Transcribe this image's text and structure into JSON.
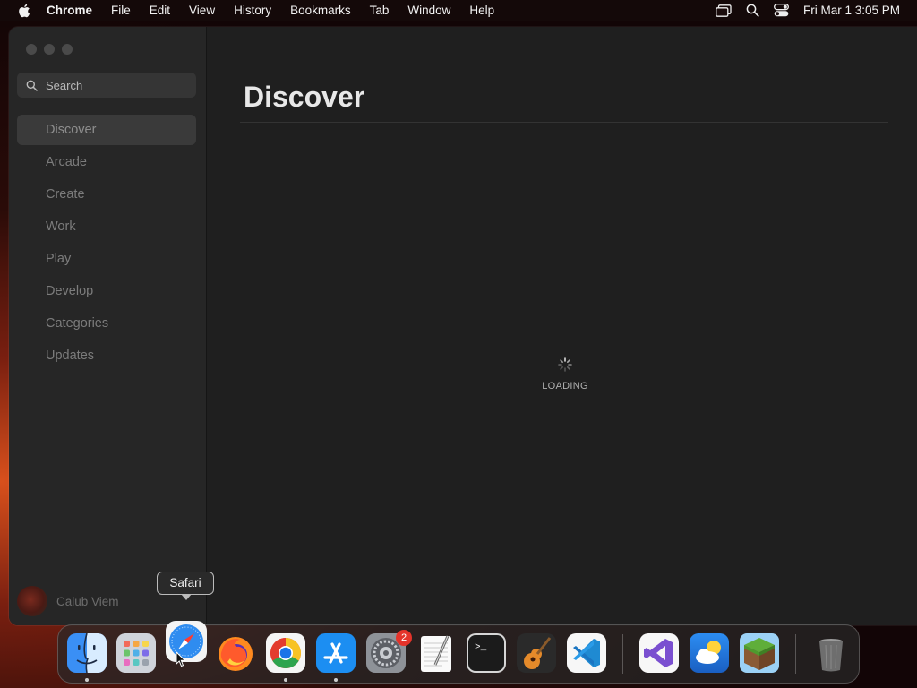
{
  "menubar": {
    "app_name": "Chrome",
    "items": [
      "File",
      "Edit",
      "View",
      "History",
      "Bookmarks",
      "Tab",
      "Window",
      "Help"
    ],
    "clock": "Fri Mar 1  3:05 PM"
  },
  "sidebar": {
    "search_placeholder": "Search",
    "items": [
      {
        "label": "Discover",
        "active": true
      },
      {
        "label": "Arcade"
      },
      {
        "label": "Create"
      },
      {
        "label": "Work"
      },
      {
        "label": "Play"
      },
      {
        "label": "Develop"
      },
      {
        "label": "Categories"
      },
      {
        "label": "Updates"
      }
    ],
    "user_name": "Calub Viem"
  },
  "main": {
    "title": "Discover",
    "loading_label": "LOADING"
  },
  "dock": {
    "tooltip": "Safari",
    "apps": [
      {
        "name": "finder-icon",
        "running": true
      },
      {
        "name": "launchpad-icon"
      },
      {
        "name": "safari-icon"
      },
      {
        "name": "firefox-icon"
      },
      {
        "name": "chrome-icon",
        "running": true
      },
      {
        "name": "app-store-icon",
        "running": true
      },
      {
        "name": "system-settings-icon",
        "badge": "2"
      },
      {
        "name": "textedit-icon"
      },
      {
        "name": "terminal-icon"
      },
      {
        "name": "garageband-icon"
      },
      {
        "name": "vscode-icon"
      },
      {
        "name": "visual-studio-icon"
      },
      {
        "name": "weather-icon"
      },
      {
        "name": "minecraft-icon"
      },
      {
        "name": "trash-icon"
      }
    ]
  },
  "colors": {
    "menubar_bg": "#140a0a",
    "window_bg": "#1f1f1f",
    "sidebar_bg": "#262626",
    "active_item_bg": "#3a3a3a",
    "badge_red": "#e5332a"
  }
}
